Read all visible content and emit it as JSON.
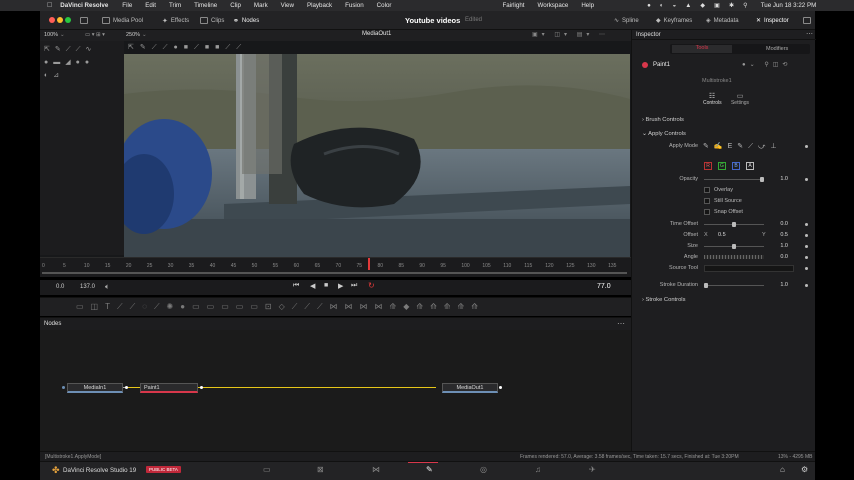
{
  "menubar": {
    "app": "DaVinci Resolve",
    "items": [
      "File",
      "Edit",
      "Trim",
      "Timeline",
      "Clip",
      "Mark",
      "View",
      "Playback",
      "Fusion",
      "Color"
    ],
    "right_items": [
      "Fairlight",
      "Workspace",
      "Help"
    ],
    "clock": "Tue Jun 18  3:22 PM"
  },
  "toolbar": {
    "media_pool": "Media Pool",
    "effects": "Effects",
    "clips": "Clips",
    "nodes": "Nodes",
    "project_title": "Youtube videos",
    "edited": "Edited",
    "spline": "Spline",
    "keyframes": "Keyframes",
    "metadata": "Metadata",
    "inspector": "Inspector"
  },
  "viewer": {
    "zoom_left": "100%",
    "zoom_right": "250%",
    "output": "MediaOut1"
  },
  "timeline": {
    "ticks": [
      "0",
      "5",
      "10",
      "15",
      "20",
      "25",
      "30",
      "35",
      "40",
      "45",
      "50",
      "55",
      "60",
      "65",
      "70",
      "75",
      "80",
      "85",
      "90",
      "95",
      "100",
      "105",
      "110",
      "115",
      "120",
      "125",
      "130",
      "135"
    ],
    "start": "0.0",
    "end": "137.0",
    "current": "77.0"
  },
  "nodes": {
    "title": "Nodes",
    "items": [
      "MediaIn1",
      "Paint1",
      "MediaOut1"
    ]
  },
  "inspector": {
    "title": "Inspector",
    "tabs": [
      "Tools",
      "Modifiers"
    ],
    "tool_name": "Paint1",
    "sub_name": "Multistroke1",
    "subtabs": [
      "Controls",
      "Settings"
    ],
    "sections": {
      "brush": "Brush Controls",
      "apply": "Apply Controls",
      "stroke": "Stroke Controls"
    },
    "apply_mode_label": "Apply Mode",
    "channels": [
      "R",
      "G",
      "B",
      "A"
    ],
    "opacity": {
      "label": "Opacity",
      "value": "1.0",
      "level": 1.0
    },
    "checkboxes": [
      "Overlay",
      "Still Source",
      "Snap Offset"
    ],
    "time_offset": {
      "label": "Time Offset",
      "value": "0.0",
      "level": 0.5
    },
    "offset": {
      "label": "Offset",
      "x_label": "X",
      "x": "0.5",
      "y_label": "Y",
      "y": "0.5"
    },
    "size": {
      "label": "Size",
      "value": "1.0",
      "level": 0.5
    },
    "angle": {
      "label": "Angle",
      "value": "0.0"
    },
    "source_tool": {
      "label": "Source Tool"
    },
    "stroke_duration": {
      "label": "Stroke Duration",
      "value": "1.0",
      "level": 0.0
    }
  },
  "status": {
    "left": "[Multistroke1.ApplyMode]",
    "right": "Frames rendered: 57.0,  Average: 3.58 frames/sec,  Time taken: 15.7 secs,  Finished at: Tue 3:20PM",
    "mem": "13% - 4295 MB"
  },
  "bottom": {
    "product": "DaVinci Resolve Studio 19",
    "badge": "PUBLIC BETA"
  },
  "colors": {
    "accent": "#d8374b",
    "playhead": "#e23a3a",
    "link": "#e6c619"
  }
}
